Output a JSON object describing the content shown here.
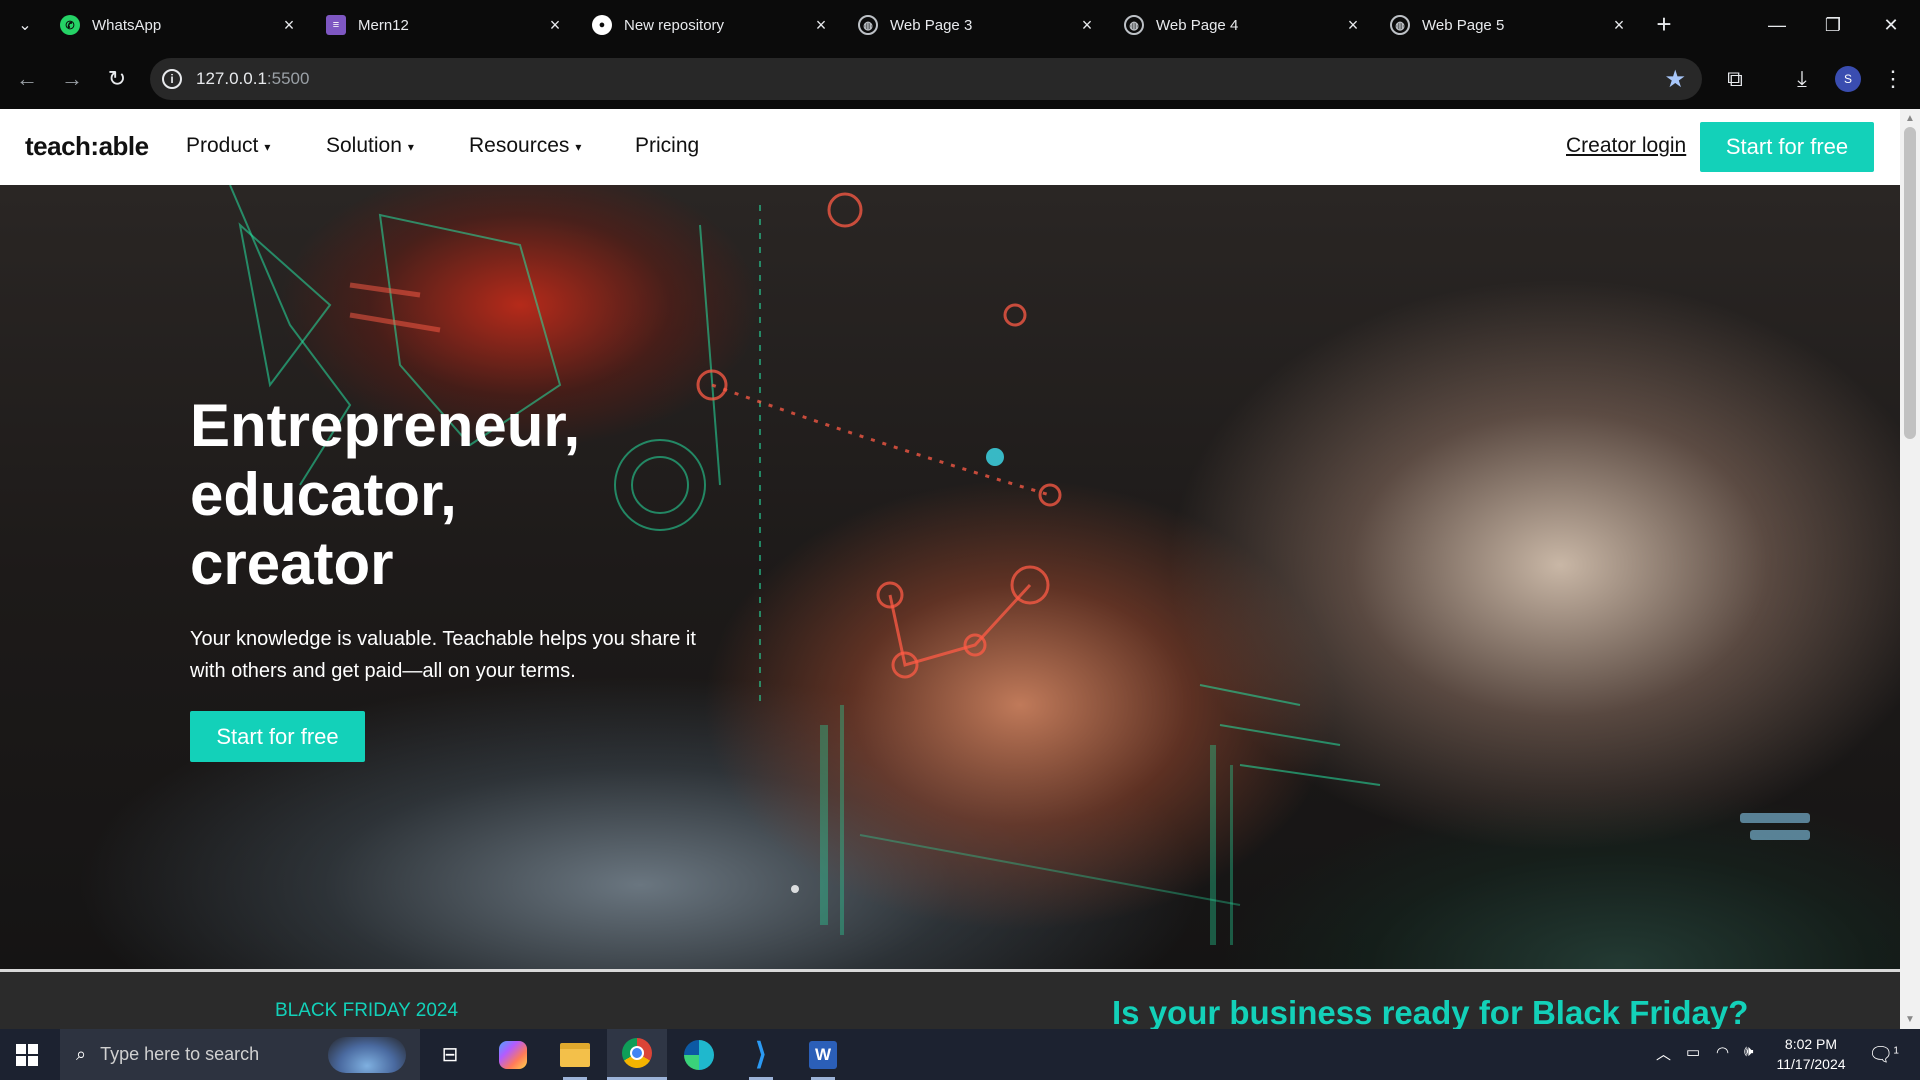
{
  "browser": {
    "tabs": [
      {
        "title": "WhatsApp",
        "icon": "whatsapp-icon",
        "color": "#25d366"
      },
      {
        "title": "Mern12",
        "icon": "list-icon",
        "color": "#7e57c2"
      },
      {
        "title": "New repository",
        "icon": "github-icon",
        "color": "#ffffff"
      },
      {
        "title": "Web Page 3",
        "icon": "globe-icon",
        "color": "#bdc1c6"
      },
      {
        "title": "Web Page 4",
        "icon": "globe-icon",
        "color": "#bdc1c6"
      },
      {
        "title": "Web Page 5",
        "icon": "globe-icon",
        "color": "#bdc1c6"
      }
    ],
    "url_host": "127.0.0.1",
    "url_port": ":5500",
    "profile_initial": "S"
  },
  "site": {
    "logo": "teach:able",
    "nav": [
      {
        "label": "Product",
        "has_dropdown": true
      },
      {
        "label": "Solution",
        "has_dropdown": true
      },
      {
        "label": "Resources",
        "has_dropdown": true
      },
      {
        "label": "Pricing",
        "has_dropdown": false
      }
    ],
    "creator_login": "Creator login",
    "nav_cta": "Start for free",
    "accent_color": "#13d1b9"
  },
  "hero": {
    "title_lines": [
      "Entrepreneur,",
      "educator,",
      "creator"
    ],
    "subtitle": "Your knowledge is valuable. Teachable helps you share it with others and get paid—all on your terms.",
    "cta": "Start for free"
  },
  "promo": {
    "label": "BLACK FRIDAY 2024",
    "heading": "Is your business ready for Black Friday?"
  },
  "taskbar": {
    "search_placeholder": "Type here to search",
    "time": "8:02 PM",
    "date": "11/17/2024",
    "notification_count": "1"
  }
}
